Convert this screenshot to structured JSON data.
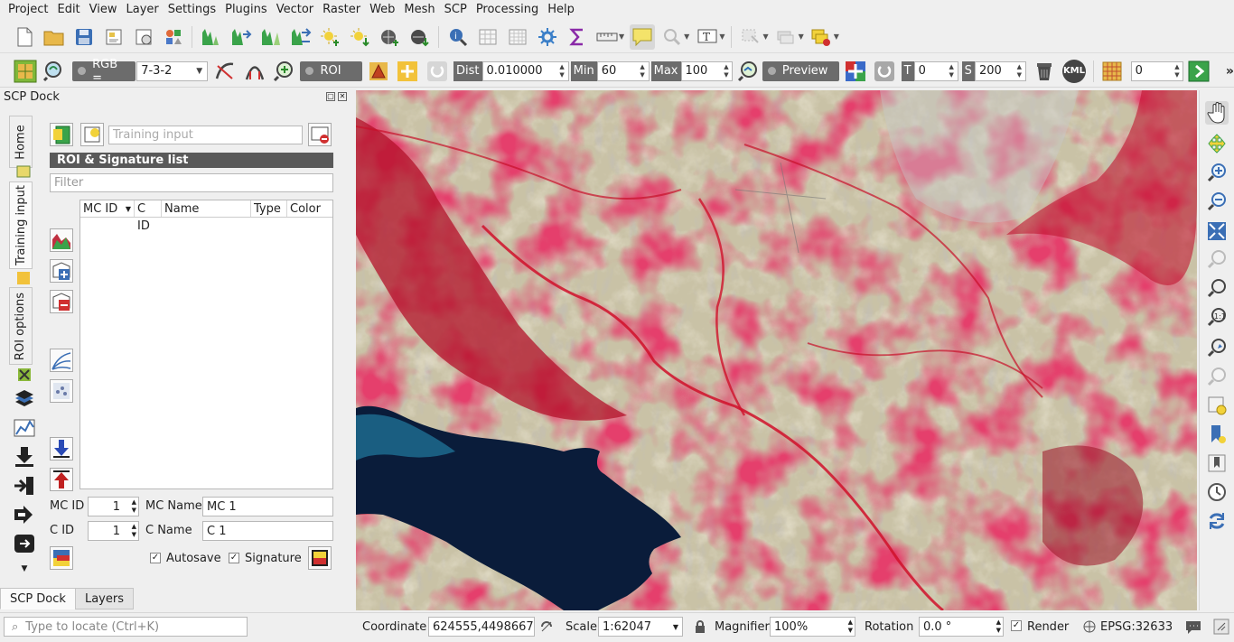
{
  "menu": [
    "Project",
    "Edit",
    "View",
    "Layer",
    "Settings",
    "Plugins",
    "Vector",
    "Raster",
    "Web",
    "Mesh",
    "SCP",
    "Processing",
    "Help"
  ],
  "toolbar2": {
    "rgb_label": "RGB =",
    "rgb_value": "7-3-2",
    "roi_label": "ROI",
    "dist_label": "Dist",
    "dist_value": "0.010000",
    "min_label": "Min",
    "min_value": "60",
    "max_label": "Max",
    "max_value": "100",
    "preview_label": "Preview",
    "t_label": "T",
    "t_value": "0",
    "s_label": "S",
    "s_value": "200",
    "kml_label": "KML",
    "band_value": "0",
    "more_label": "»"
  },
  "dock": {
    "title": "SCP Dock",
    "vtabs": [
      "Home",
      "Training input",
      "ROI options"
    ],
    "training_input_placeholder": "Training input",
    "roi_header": "ROI & Signature list",
    "filter_placeholder": "Filter",
    "table_columns": [
      "MC ID",
      "C ID",
      "Name",
      "Type",
      "Color"
    ],
    "mc_id_label": "MC ID",
    "mc_id_value": "1",
    "mc_name_label": "MC Name",
    "mc_name_value": "MC 1",
    "c_id_label": "C ID",
    "c_id_value": "1",
    "c_name_label": "C Name",
    "c_name_value": "C 1",
    "autosave_label": "Autosave",
    "signature_label": "Signature",
    "tabs": [
      "SCP Dock",
      "Layers"
    ]
  },
  "status": {
    "locate_placeholder": "Type to locate (Ctrl+K)",
    "coordinate_label": "Coordinate",
    "coordinate_value": "624555,4498667",
    "scale_label": "Scale",
    "scale_value": "1:62047",
    "magnifier_label": "Magnifier",
    "magnifier_value": "100%",
    "rotation_label": "Rotation",
    "rotation_value": "0.0 °",
    "render_label": "Render",
    "crs_label": "EPSG:32633"
  }
}
